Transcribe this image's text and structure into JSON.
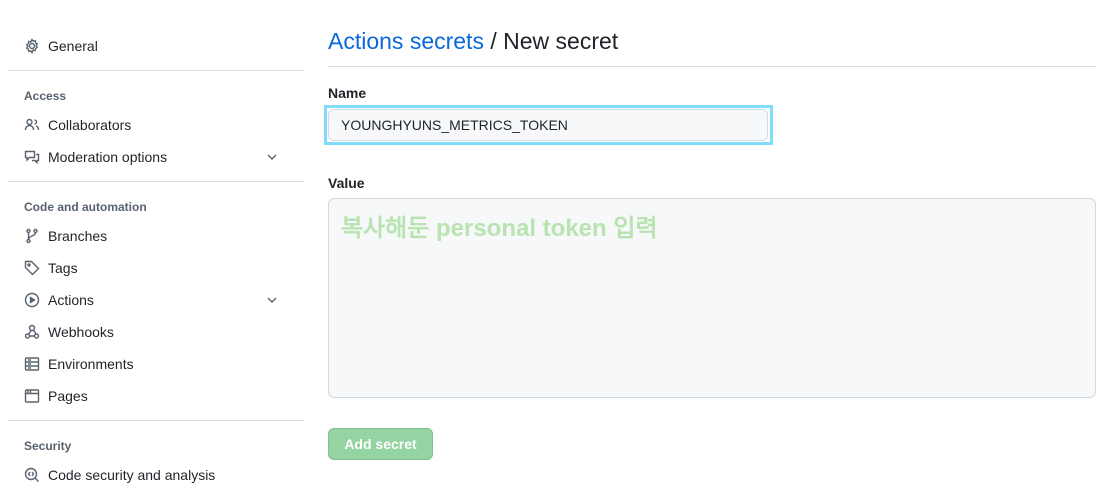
{
  "sidebar": {
    "general": "General",
    "sections": [
      {
        "heading": "Access",
        "items": [
          "Collaborators",
          "Moderation options"
        ]
      },
      {
        "heading": "Code and automation",
        "items": [
          "Branches",
          "Tags",
          "Actions",
          "Webhooks",
          "Environments",
          "Pages"
        ]
      },
      {
        "heading": "Security",
        "items": [
          "Code security and analysis"
        ]
      }
    ]
  },
  "main": {
    "breadcrumb_link": "Actions secrets",
    "breadcrumb_sep": " / ",
    "title": "New secret",
    "name_label": "Name",
    "name_value": "YOUNGHYUNS_METRICS_TOKEN",
    "value_label": "Value",
    "value_annotation": "복사해둔 personal token 입력",
    "submit": "Add secret"
  },
  "colors": {
    "link": "#0969da",
    "highlight": "#7fdcfa",
    "button": "#94d3a2",
    "annotation": "#b9e3b1"
  }
}
